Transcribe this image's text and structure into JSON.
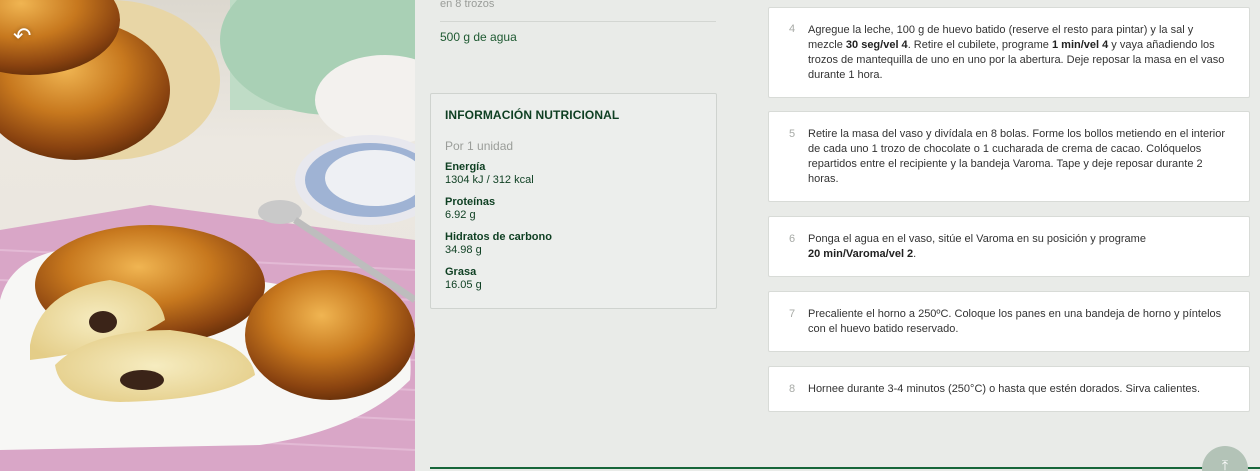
{
  "photo": {
    "alt_subject": "bread-rolls-photo"
  },
  "nav": {
    "back_icon": "↶"
  },
  "ingredients": {
    "clipped_line": "en 8 trozos",
    "water": "500 g de agua"
  },
  "nutrition": {
    "title": "INFORMACIÓN NUTRICIONAL",
    "per": "Por 1 unidad",
    "items": [
      {
        "label": "Energía",
        "value": "1304 kJ / 312 kcal"
      },
      {
        "label": "Proteínas",
        "value": "6.92 g"
      },
      {
        "label": "Hidratos de carbono",
        "value": "34.98 g"
      },
      {
        "label": "Grasa",
        "value": "16.05 g"
      }
    ]
  },
  "steps": [
    {
      "num": "4",
      "parts": [
        {
          "t": "Agregue la leche, 100 g de huevo batido (reserve el resto para pintar) y la sal y mezcle "
        },
        {
          "t": "30 seg/vel 4",
          "b": true
        },
        {
          "t": ". Retire el cubilete, programe "
        },
        {
          "t": "1 min/vel 4",
          "b": true
        },
        {
          "t": " y vaya añadiendo los trozos de mantequilla de uno en uno por la abertura. Deje reposar la masa en el vaso durante 1 hora."
        }
      ]
    },
    {
      "num": "5",
      "parts": [
        {
          "t": "Retire la masa del vaso y divídala en 8 bolas. Forme los bollos metiendo en el interior de cada uno 1 trozo de chocolate o 1 cucharada de crema de cacao. Colóquelos repartidos entre el recipiente y la bandeja Varoma. Tape y deje reposar durante 2 horas."
        }
      ]
    },
    {
      "num": "6",
      "parts": [
        {
          "t": "Ponga el agua en el vaso, sitúe el Varoma en su posición y programe "
        },
        {
          "t": "20 min/Varoma/vel 2",
          "b": true,
          "br": true
        },
        {
          "t": "."
        }
      ]
    },
    {
      "num": "7",
      "parts": [
        {
          "t": "Precaliente el horno a 250ºC. Coloque los panes en una bandeja de horno y píntelos con el huevo batido reservado."
        }
      ]
    },
    {
      "num": "8",
      "parts": [
        {
          "t": "Hornee durante 3-4 minutos (250°C) o hasta que estén dorados. Sirva calientes."
        }
      ]
    }
  ],
  "scroll_top": {
    "icon": "⤒"
  },
  "colors": {
    "accent": "#17663a",
    "heading": "#0e3f22"
  }
}
